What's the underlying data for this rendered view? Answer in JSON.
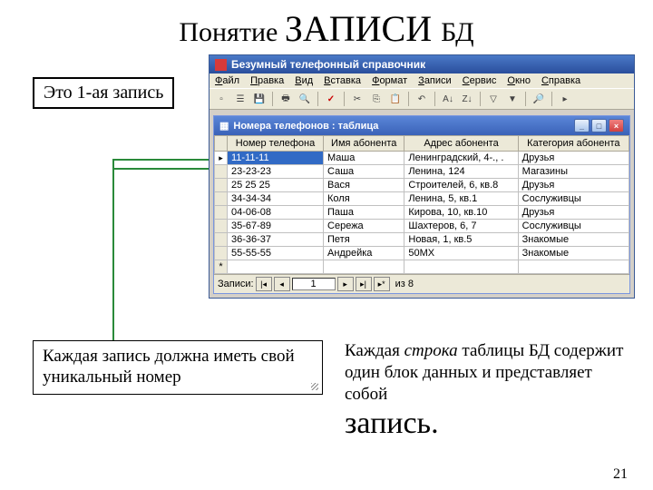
{
  "title_prefix": "Понятие ",
  "title_big": "ЗАПИСИ ",
  "title_suffix": "БД",
  "callout1": "Это 1-ая запись",
  "callout2": "Каждая запись должна иметь свой уникальный номер",
  "text3_l1a": "Каждая ",
  "text3_l1b": "строка",
  "text3_l1c": " таблицы БД содержит один блок данных и представляет собой",
  "text3_big": "запись",
  "pagenum": "21",
  "app": {
    "title": "Безумный телефонный справочник",
    "menu": [
      "Файл",
      "Правка",
      "Вид",
      "Вставка",
      "Формат",
      "Записи",
      "Сервис",
      "Окно",
      "Справка"
    ]
  },
  "child": {
    "title": "Номера телефонов : таблица",
    "columns": [
      "Номер телефона",
      "Имя абонента",
      "Адрес абонента",
      "Категория абонента"
    ],
    "rows": [
      {
        "c": [
          "11-11-11",
          "Маша",
          "Ленинградский, 4-., .",
          "Друзья"
        ],
        "current": true
      },
      {
        "c": [
          "23-23-23",
          "Саша",
          "Ленина, 124",
          "Магазины"
        ]
      },
      {
        "c": [
          "25 25 25",
          "Вася",
          "Строителей, 6, кв.8",
          "Друзья"
        ]
      },
      {
        "c": [
          "34-34-34",
          "Коля",
          "Ленина, 5, кв.1",
          "Сослуживцы"
        ]
      },
      {
        "c": [
          "04-06-08",
          "Паша",
          "Кирова, 10, кв.10",
          "Друзья"
        ]
      },
      {
        "c": [
          "35-67-89",
          "Сережа",
          "Шахтеров, 6, 7",
          "Сослуживцы"
        ]
      },
      {
        "c": [
          "36-36-37",
          "Петя",
          "Новая, 1, кв.5",
          "Знакомые"
        ]
      },
      {
        "c": [
          "55-55-55",
          "Андрейка",
          "50MX",
          "Знакомые"
        ]
      }
    ],
    "nav_label": "Записи:",
    "nav_value": "1",
    "nav_total": "из 8"
  }
}
